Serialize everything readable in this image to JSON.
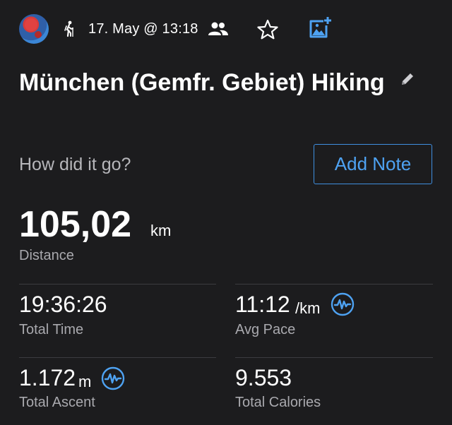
{
  "header": {
    "date": "17. May @ 13:18",
    "icons": [
      "avatar",
      "hiking-icon",
      "people-icon",
      "star-icon",
      "add-photo-icon"
    ]
  },
  "activity": {
    "title": "München (Gemfr. Gebiet) Hiking"
  },
  "note": {
    "prompt": "How did it go?",
    "button": "Add Note"
  },
  "distance": {
    "value": "105,02",
    "unit": "km",
    "label": "Distance"
  },
  "stats": {
    "total_time": {
      "value": "19:36:26",
      "label": "Total Time"
    },
    "avg_pace": {
      "value": "11:12",
      "unit": "/km",
      "label": "Avg Pace",
      "icon": "performance-icon"
    },
    "total_ascent": {
      "value": "1.172",
      "unit": "m",
      "label": "Total Ascent",
      "icon": "performance-icon"
    },
    "total_calories": {
      "value": "9.553",
      "label": "Total Calories"
    }
  },
  "colors": {
    "background": "#1c1c1e",
    "accent": "#4ea2f2",
    "text_secondary": "#a9a9ae"
  }
}
